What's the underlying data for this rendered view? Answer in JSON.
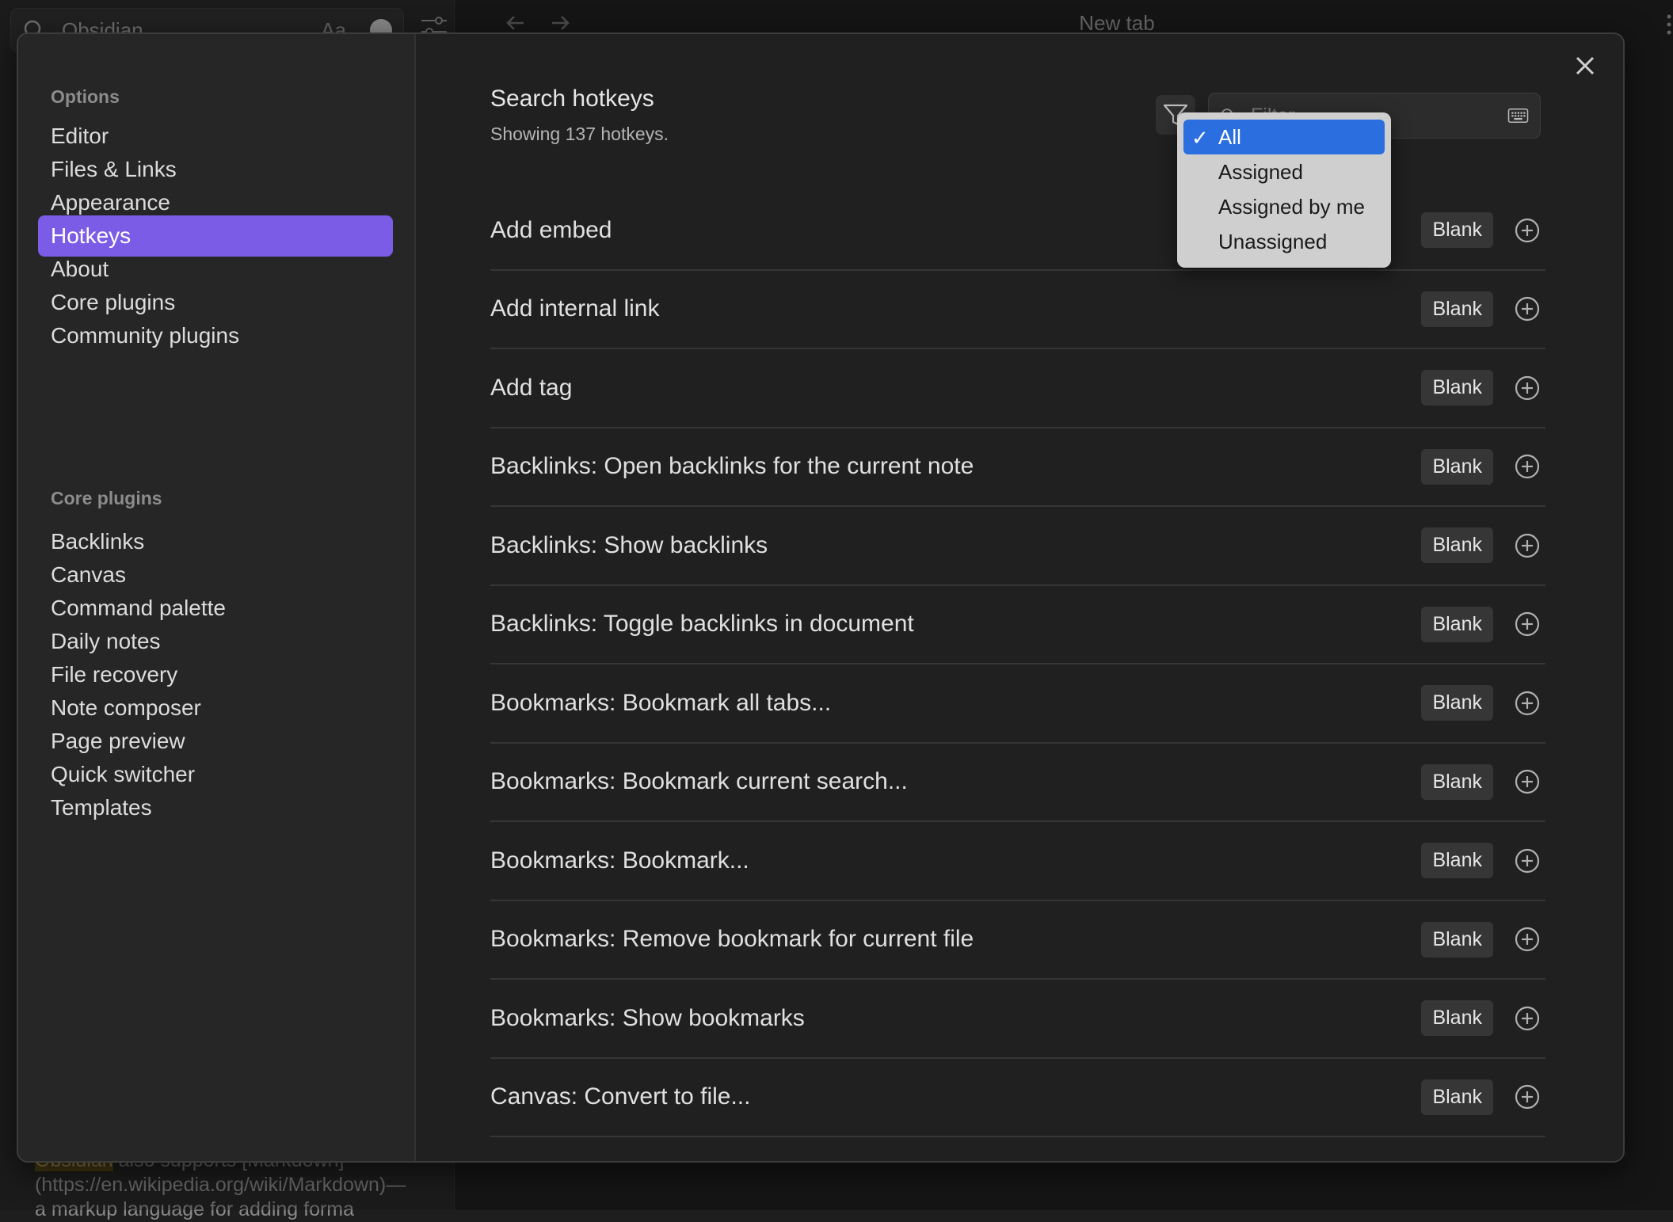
{
  "background": {
    "search": {
      "value": "Obsidian",
      "aa_label": "Aa"
    },
    "tab_title": "New tab",
    "note_text": {
      "highlight": "Obsidian",
      "line1_rest": " also supports [Markdown]",
      "line2": "(https://en.wikipedia.org/wiki/Markdown)—",
      "line3": "a markup language for adding forma"
    }
  },
  "sidebar": {
    "options_heading": "Options",
    "options_items": [
      {
        "label": "Editor"
      },
      {
        "label": "Files & Links"
      },
      {
        "label": "Appearance"
      },
      {
        "label": "Hotkeys"
      },
      {
        "label": "About"
      },
      {
        "label": "Core plugins"
      },
      {
        "label": "Community plugins"
      }
    ],
    "active_item": "Hotkeys",
    "core_heading": "Core plugins",
    "core_items": [
      {
        "label": "Backlinks"
      },
      {
        "label": "Canvas"
      },
      {
        "label": "Command palette"
      },
      {
        "label": "Daily notes"
      },
      {
        "label": "File recovery"
      },
      {
        "label": "Note composer"
      },
      {
        "label": "Page preview"
      },
      {
        "label": "Quick switcher"
      },
      {
        "label": "Templates"
      }
    ]
  },
  "hotkeys": {
    "title": "Search hotkeys",
    "subtitle": "Showing 137 hotkeys.",
    "filter_placeholder": "Filter...",
    "rows": [
      {
        "label": "Add embed",
        "hotkey": "Blank"
      },
      {
        "label": "Add internal link",
        "hotkey": "Blank"
      },
      {
        "label": "Add tag",
        "hotkey": "Blank"
      },
      {
        "label": "Backlinks: Open backlinks for the current note",
        "hotkey": "Blank"
      },
      {
        "label": "Backlinks: Show backlinks",
        "hotkey": "Blank"
      },
      {
        "label": "Backlinks: Toggle backlinks in document",
        "hotkey": "Blank"
      },
      {
        "label": "Bookmarks: Bookmark all tabs...",
        "hotkey": "Blank"
      },
      {
        "label": "Bookmarks: Bookmark current search...",
        "hotkey": "Blank"
      },
      {
        "label": "Bookmarks: Bookmark...",
        "hotkey": "Blank"
      },
      {
        "label": "Bookmarks: Remove bookmark for current file",
        "hotkey": "Blank"
      },
      {
        "label": "Bookmarks: Show bookmarks",
        "hotkey": "Blank"
      },
      {
        "label": "Canvas: Convert to file...",
        "hotkey": "Blank"
      }
    ]
  },
  "filter_menu": {
    "options": [
      {
        "label": "All",
        "selected": true
      },
      {
        "label": "Assigned",
        "selected": false
      },
      {
        "label": "Assigned by me",
        "selected": false
      },
      {
        "label": "Unassigned",
        "selected": false
      }
    ],
    "check_glyph": "✓"
  },
  "colors": {
    "accent": "#7b5ce6",
    "menu_selected": "#2a6ee0",
    "background": "#202020"
  },
  "icons": {
    "close": "close-icon",
    "filter": "filter-icon",
    "search": "search-icon",
    "keyboard": "keyboard-icon",
    "add": "plus-circle-icon"
  }
}
